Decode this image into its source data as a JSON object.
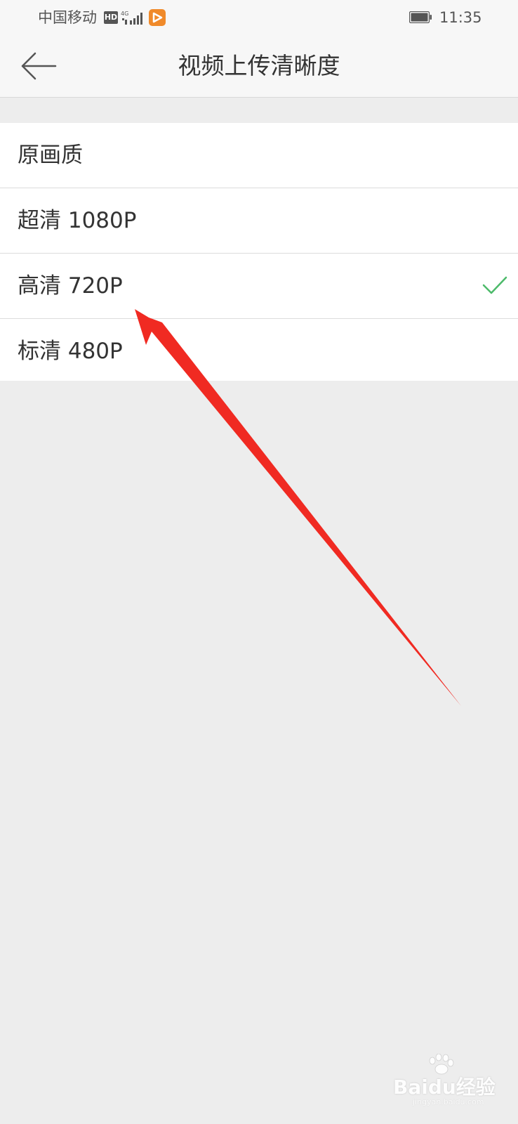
{
  "status_bar": {
    "carrier": "中国移动",
    "hd_badge": "HD",
    "network": "4G",
    "time": "11:35",
    "icons": [
      "hd-icon",
      "signal-icon",
      "app-notification-icon",
      "battery-icon"
    ]
  },
  "header": {
    "title": "视频上传清晰度",
    "back_icon": "arrow-left-icon"
  },
  "options": [
    {
      "label": "原画质",
      "selected": false
    },
    {
      "label": "超清 1080P",
      "selected": false
    },
    {
      "label": "高清 720P",
      "selected": true
    },
    {
      "label": "标清 480P",
      "selected": false
    }
  ],
  "colors": {
    "check": "#4cba6a",
    "annotation_arrow": "#f02a22",
    "background": "#ededed",
    "app_badge": "#f08a2a"
  },
  "watermark": {
    "main": "Baidu经验",
    "sub": "jingyan.baidu.com"
  }
}
